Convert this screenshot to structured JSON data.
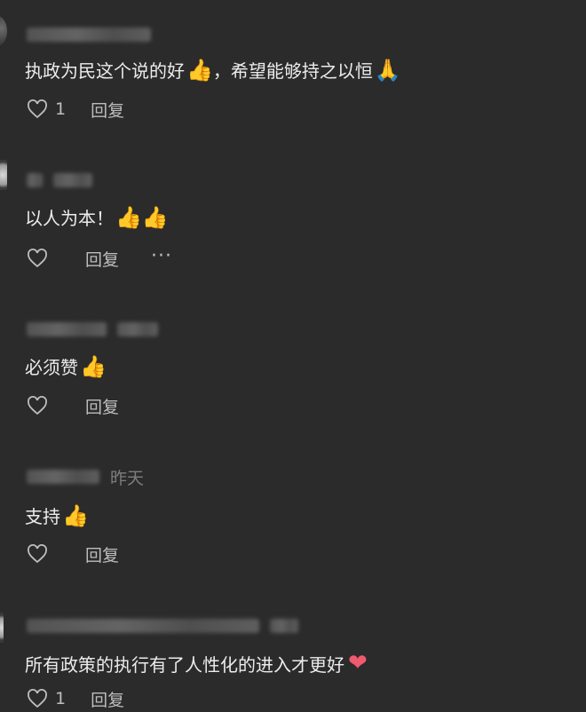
{
  "comments": [
    {
      "text": "执政为民这个说的好",
      "emoji1": "👍",
      "text2": "，希望能够持之以恒",
      "emoji2": "🙏",
      "likes": "1",
      "reply_label": "回复"
    },
    {
      "text": "以人为本！",
      "emoji1": "👍👍",
      "reply_label": "回复",
      "more_label": "···"
    },
    {
      "text": "必须赞",
      "emoji1": "👍",
      "reply_label": "回复"
    },
    {
      "time": "昨天",
      "text": "支持",
      "emoji1": "👍",
      "reply_label": "回复"
    },
    {
      "text": "所有政策的执行有了人性化的进入才更好",
      "emoji1": "❤",
      "likes": "1",
      "reply_label": "回复"
    }
  ],
  "icons": {
    "like": "heart-outline-icon",
    "more": "more-dots-icon"
  },
  "colors": {
    "background": "#2b2b2b",
    "text": "#ececec",
    "muted": "#7d7d7d",
    "heart_red": "#f05a6e"
  }
}
